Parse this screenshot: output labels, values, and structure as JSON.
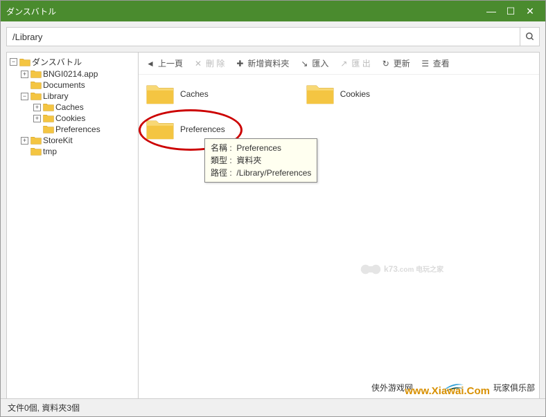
{
  "window": {
    "title": "ダンスバトル"
  },
  "pathbar": {
    "path": "/Library"
  },
  "sidebar": {
    "items": [
      {
        "label": "ダンスバトル",
        "expanded": true,
        "level": 0
      },
      {
        "label": "BNGI0214.app",
        "expanded": false,
        "level": 1
      },
      {
        "label": "Documents",
        "expanded": null,
        "level": 1
      },
      {
        "label": "Library",
        "expanded": true,
        "level": 1
      },
      {
        "label": "Caches",
        "expanded": false,
        "level": 2
      },
      {
        "label": "Cookies",
        "expanded": false,
        "level": 2
      },
      {
        "label": "Preferences",
        "expanded": null,
        "level": 2
      },
      {
        "label": "StoreKit",
        "expanded": false,
        "level": 1
      },
      {
        "label": "tmp",
        "expanded": null,
        "level": 1
      }
    ]
  },
  "toolbar": {
    "back": "上一頁",
    "delete": "刪 除",
    "newfolder": "新增資料夾",
    "import": "匯入",
    "export": "匯 出",
    "refresh": "更新",
    "view": "查看"
  },
  "files": [
    {
      "label": "Caches"
    },
    {
      "label": "Cookies"
    },
    {
      "label": "Preferences"
    }
  ],
  "tooltip": {
    "name_key": "名稱",
    "name_val": "Preferences",
    "type_key": "類型",
    "type_val": "資料夾",
    "path_key": "路徑",
    "path_val": "/Library/Preferences"
  },
  "watermarks": {
    "k73": "k73",
    "k73_sub": ".com 电玩之家",
    "wai1": "侠外游戏网",
    "wai2": "玩家俱乐部",
    "xiawai": "www.Xiawai.Com"
  },
  "statusbar": {
    "text": "文件0個, 資料夾3個"
  }
}
